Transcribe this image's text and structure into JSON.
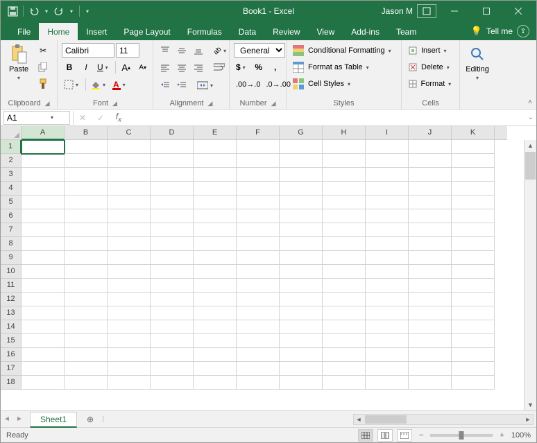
{
  "title": "Book1 - Excel",
  "user": "Jason M",
  "tabs": [
    "File",
    "Home",
    "Insert",
    "Page Layout",
    "Formulas",
    "Data",
    "Review",
    "View",
    "Add-ins",
    "Team"
  ],
  "active_tab": "Home",
  "tellme": "Tell me",
  "ribbon": {
    "clipboard": {
      "label": "Clipboard",
      "paste": "Paste"
    },
    "font": {
      "label": "Font",
      "name": "Calibri",
      "size": "11",
      "bold": "B",
      "italic": "I",
      "underline": "U"
    },
    "alignment": {
      "label": "Alignment"
    },
    "number": {
      "label": "Number",
      "format": "General"
    },
    "styles": {
      "label": "Styles",
      "cond": "Conditional Formatting",
      "table": "Format as Table",
      "cell": "Cell Styles"
    },
    "cells": {
      "label": "Cells",
      "insert": "Insert",
      "delete": "Delete",
      "format": "Format"
    },
    "editing": {
      "label": "Editing"
    }
  },
  "namebox": "A1",
  "columns": [
    "A",
    "B",
    "C",
    "D",
    "E",
    "F",
    "G",
    "H",
    "I",
    "J",
    "K"
  ],
  "rows": [
    "1",
    "2",
    "3",
    "4",
    "5",
    "6",
    "7",
    "8",
    "9",
    "10",
    "11",
    "12",
    "13",
    "14",
    "15",
    "16",
    "17",
    "18"
  ],
  "active_cell": "A1",
  "sheet": "Sheet1",
  "status": "Ready",
  "zoom": "100%"
}
